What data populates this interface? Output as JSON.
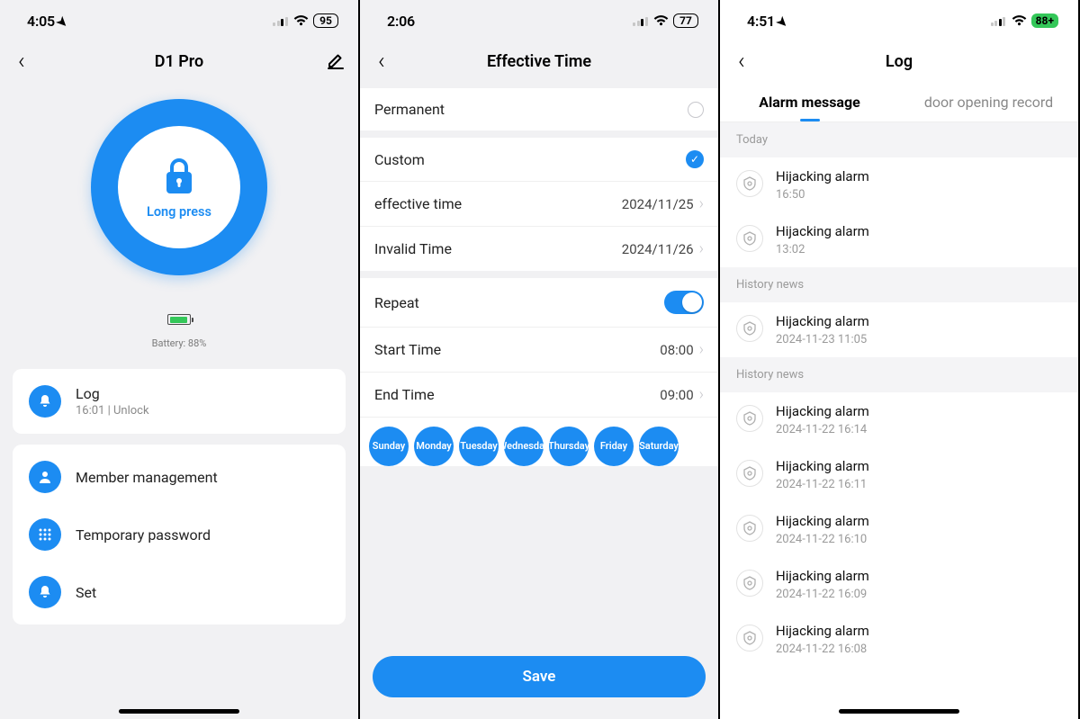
{
  "s1": {
    "status": {
      "time": "4:05",
      "hasLoc": true,
      "battery": "95",
      "batteryStyle": "plain"
    },
    "nav": {
      "title": "D1 Pro"
    },
    "dial": {
      "label": "Long press"
    },
    "battery": {
      "label": "Battery: 88%"
    },
    "log": {
      "title": "Log",
      "sub": "16:01 | Unlock"
    },
    "menu": {
      "member": "Member management",
      "temp": "Temporary password",
      "set": "Set"
    }
  },
  "s2": {
    "status": {
      "time": "2:06",
      "hasLoc": false,
      "battery": "77",
      "batteryStyle": "plain"
    },
    "nav": {
      "title": "Effective Time"
    },
    "permanent": "Permanent",
    "custom": "Custom",
    "effectiveTime": {
      "label": "effective time",
      "value": "2024/11/25"
    },
    "invalidTime": {
      "label": "Invalid Time",
      "value": "2024/11/26"
    },
    "repeat": "Repeat",
    "startTime": {
      "label": "Start Time",
      "value": "08:00"
    },
    "endTime": {
      "label": "End Time",
      "value": "09:00"
    },
    "days": [
      "Sunday",
      "Monday",
      "Tuesday",
      "Wednesday",
      "Thursday",
      "Friday",
      "Saturday"
    ],
    "save": "Save"
  },
  "s3": {
    "status": {
      "time": "4:51",
      "hasLoc": true,
      "battery": "88",
      "batteryStyle": "green"
    },
    "nav": {
      "title": "Log"
    },
    "tabs": {
      "alarm": "Alarm message",
      "door": "door opening record"
    },
    "sections": [
      {
        "header": "Today",
        "items": [
          {
            "title": "Hijacking alarm",
            "time": "16:50"
          },
          {
            "title": "Hijacking alarm",
            "time": "13:02"
          }
        ]
      },
      {
        "header": "History news",
        "items": [
          {
            "title": "Hijacking alarm",
            "time": "2024-11-23 11:05"
          }
        ]
      },
      {
        "header": "History news",
        "items": [
          {
            "title": "Hijacking alarm",
            "time": "2024-11-22 16:14"
          },
          {
            "title": "Hijacking alarm",
            "time": "2024-11-22 16:11"
          },
          {
            "title": "Hijacking alarm",
            "time": "2024-11-22 16:10"
          },
          {
            "title": "Hijacking alarm",
            "time": "2024-11-22 16:09"
          },
          {
            "title": "Hijacking alarm",
            "time": "2024-11-22 16:08"
          }
        ]
      }
    ]
  }
}
